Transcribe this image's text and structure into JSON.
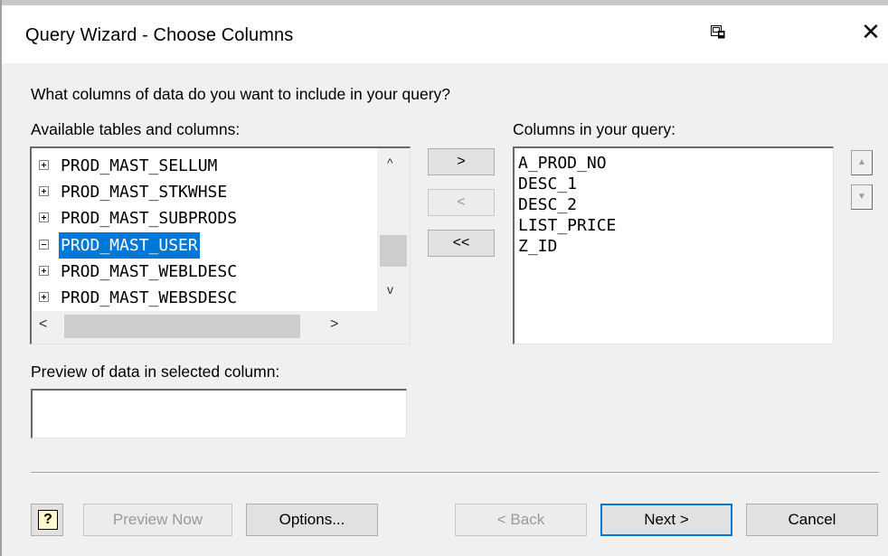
{
  "window": {
    "title": "Query Wizard - Choose Columns",
    "close_glyph": "✕"
  },
  "prompt": "What columns of data do you want to include in your query?",
  "available": {
    "label": "Available tables and columns:",
    "items": [
      {
        "label": "PROD_MAST_SELLUM",
        "expander": "plus"
      },
      {
        "label": "PROD_MAST_STKWHSE",
        "expander": "plus"
      },
      {
        "label": "PROD_MAST_SUBPRODS",
        "expander": "plus"
      },
      {
        "label": "PROD_MAST_USER",
        "expander": "minus",
        "selected": true
      },
      {
        "label": "PROD_MAST_WEBLDESC",
        "expander": "plus"
      },
      {
        "label": "PROD_MAST_WEBSDESC",
        "expander": "plus"
      }
    ],
    "scroll_up_glyph": "^",
    "scroll_down_glyph": "v",
    "scroll_left_glyph": "<",
    "scroll_right_glyph": ">"
  },
  "transfer_buttons": {
    "add": ">",
    "remove": "<",
    "remove_all": "<<"
  },
  "query_columns": {
    "label": "Columns in your query:",
    "items": [
      "A_PROD_NO",
      "DESC_1",
      "DESC_2",
      "LIST_PRICE",
      "Z_ID"
    ],
    "move_up_glyph": "▲",
    "move_down_glyph": "▼"
  },
  "preview": {
    "label": "Preview of data in selected column:",
    "value": ""
  },
  "footer": {
    "help_glyph": "?",
    "preview_now": "Preview Now",
    "options": "Options...",
    "back": "< Back",
    "next": "Next >",
    "cancel": "Cancel"
  },
  "colors": {
    "selection": "#0078d7",
    "window_bg": "#f0f0f0"
  }
}
